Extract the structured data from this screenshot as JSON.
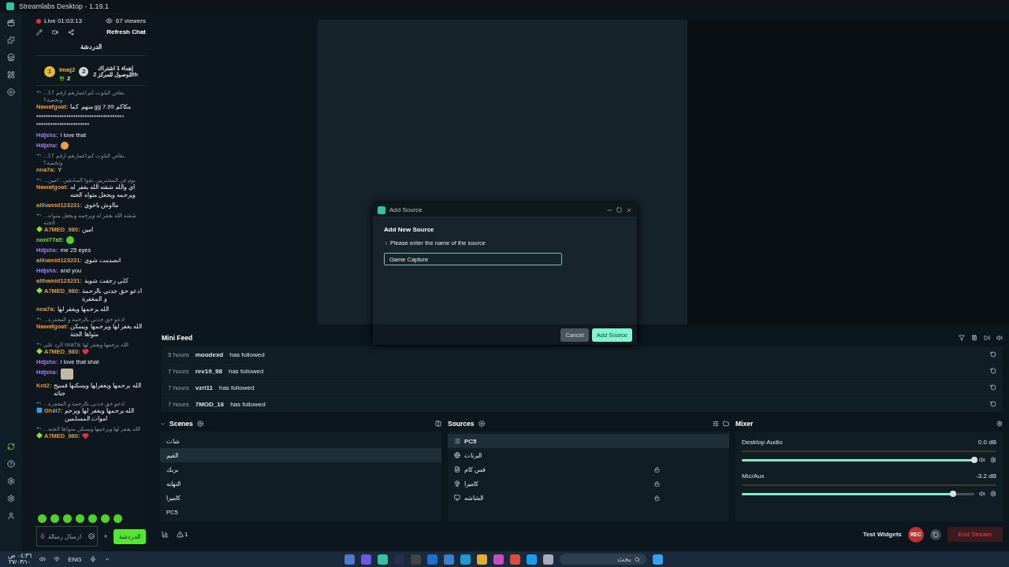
{
  "window": {
    "title": "Streamlabs Desktop - 1.19.1"
  },
  "chat": {
    "live": "Live 01:03:13",
    "viewers": "67 viewers",
    "refresh": "Refresh Chat",
    "title": "الدردشة",
    "leader": {
      "rank": "1",
      "name": "lmaj2",
      "gifts": "2",
      "next_rank": "2",
      "note": "إهداء 1 اشتراك للوصول للمركز 2th"
    },
    "messages": [
      {
        "kind": "text",
        "reply": "...يقاص البلوت كم اعمارهم ارقم 17 وتحمية؟",
        "user": "Nawafgoat:",
        "color": "#e89b3c",
        "text": "مكاكم gg 7.99 منهم كما"
      },
      {
        "kind": "plain",
        "text": "*************************************^ ***********************"
      },
      {
        "kind": "text",
        "user": "Hdjshs:",
        "color": "#a880f2",
        "text": "I love that"
      },
      {
        "kind": "emote",
        "user": "Hdjshs:",
        "color": "#a880f2"
      },
      {
        "kind": "text",
        "reply": "...يقاص البلوت كم اعمارهم ارقم 17 وتحمية؟",
        "user": "nna7a:",
        "color": "#dca24c",
        "text": "Y"
      },
      {
        "kind": "text",
        "reply": "...يوم عن المشتريين بقوا السابقين : امين",
        "user": "Nawafgoat:",
        "color": "#e89b3c",
        "text": "اي والله شفته الله يغفر له ويرحمه ويجعل مثواه الجنه"
      },
      {
        "kind": "text",
        "user": "alihamid123231:",
        "color": "#e39a3a",
        "text": "مااوش ياخوي"
      },
      {
        "kind": "text",
        "reply": "...شفته الله يغفر له ويرحمه ويجعل مثواه الجنه",
        "badge": {
          "kind": "diamond"
        },
        "user": "A7MED_980:",
        "color": "#e39a3a",
        "text": "امين"
      },
      {
        "kind": "sticker",
        "user": "noni77a5:",
        "color": "#7fdc3c"
      },
      {
        "kind": "text",
        "user": "Hdjshs:",
        "color": "#a880f2",
        "text": "me 25 eyes"
      },
      {
        "kind": "text",
        "user": "alihamid123231:",
        "color": "#e39a3a",
        "text": "انصدمت شوي"
      },
      {
        "kind": "text",
        "user": "Hdjshs:",
        "color": "#a880f2",
        "text": "and you"
      },
      {
        "kind": "text",
        "user": "alihamid123231:",
        "color": "#e39a3a",
        "text": "كلي رجفت شوية"
      },
      {
        "kind": "text",
        "badge": {
          "kind": "diamond"
        },
        "user": "A7MED_980:",
        "color": "#e39a3a",
        "text": "ادعو حق جدتي بالرحمة و المغفرة"
      },
      {
        "kind": "text",
        "user": "nna7a:",
        "color": "#dca24c",
        "text": "الله يرحمها ويغفر لها"
      },
      {
        "kind": "text",
        "reply": "...ادعو حق جدتي بالرحمة و المغفرة",
        "user": "Nawafgoat:",
        "color": "#e89b3c",
        "text": "الله يغفر لها ويرحمها ويسكن مثواها الجنة"
      },
      {
        "kind": "heart",
        "reply": "الرد على nna7a: الله يرحمها ويغفر لها",
        "badge": {
          "kind": "diamond"
        },
        "user": "A7MED_980:",
        "color": "#e39a3a"
      },
      {
        "kind": "text",
        "user": "Hdjshs:",
        "color": "#a880f2",
        "text": "I love that shat"
      },
      {
        "kind": "photo",
        "user": "Hdjshs:",
        "color": "#a880f2"
      },
      {
        "kind": "text",
        "user": "Knt2:",
        "color": "#e39a3a",
        "text": "الله يرحمها ويغفرلها ويسكنها فسيح جناته"
      },
      {
        "kind": "text",
        "reply": "...ادعو حق جدتي بالرحمة و المغفرة",
        "badge": {
          "kind": "skater"
        },
        "user": "Ghiii7:",
        "color": "#e39a3a",
        "text": "الله يرحمها ويغفر لها ويرحم اموات المسلمين"
      },
      {
        "kind": "heart",
        "reply": "...الله يغفر لها ويرحمها ويسكن مثواها الجنة",
        "badge": {
          "kind": "diamond"
        },
        "user": "A7MED_980:",
        "color": "#e39a3a"
      }
    ],
    "input": {
      "placeholder": "ارسال رسالة"
    },
    "send": "الدردشة"
  },
  "dialog": {
    "title": "Add Source",
    "heading": "Add New Source",
    "prompt": "Please enter the name of the source",
    "value": "Game Capture",
    "cancel": "Cancel",
    "confirm": "Add Source"
  },
  "mini_feed": {
    "title": "Mini Feed",
    "rows": [
      {
        "time": "5 hours",
        "user": "moodexd",
        "action": "has followed"
      },
      {
        "time": "7 hours",
        "user": "rev19_98",
        "action": "has followed"
      },
      {
        "time": "7 hours",
        "user": "vzri11",
        "action": "has followed"
      },
      {
        "time": "7 hours",
        "user": "7MOD_16",
        "action": "has followed"
      }
    ]
  },
  "scenes": {
    "title": "Scenes",
    "items": [
      {
        "name": "شات",
        "selected": false
      },
      {
        "name": "القيم",
        "selected": true
      },
      {
        "name": "بربك",
        "selected": false
      },
      {
        "name": "النهايه",
        "selected": false
      },
      {
        "name": "كاميرا",
        "selected": false
      },
      {
        "name": "PC5",
        "selected": false
      }
    ]
  },
  "sources": {
    "title": "Sources",
    "items": [
      {
        "kind": "scene",
        "name": "PC5",
        "selected": true,
        "locked": false
      },
      {
        "kind": "browser",
        "name": "البرنات",
        "selected": false,
        "locked": false
      },
      {
        "kind": "media",
        "name": "فس كام",
        "selected": false,
        "locked": true
      },
      {
        "kind": "webcam",
        "name": "كاميرا",
        "selected": false,
        "locked": true
      },
      {
        "kind": "display",
        "name": "الشاشه",
        "selected": false,
        "locked": true
      }
    ]
  },
  "mixer": {
    "title": "Mixer",
    "channels": [
      {
        "name": "Desktop Audio",
        "reading": "0.0 dB",
        "level": 1.0
      },
      {
        "name": "Mic/Aux",
        "reading": "-3.2 dB",
        "level": 0.91
      }
    ]
  },
  "footer": {
    "alerts": "1",
    "test_widgets": "Test Widgets",
    "rec": "REC",
    "end_stream": "End Stream"
  },
  "taskbar": {
    "time": "٠٤:٣٦ ص",
    "date": "٢٧/٠٣/١٠",
    "language": "ENG",
    "search": {
      "placeholder": "بحث"
    }
  }
}
